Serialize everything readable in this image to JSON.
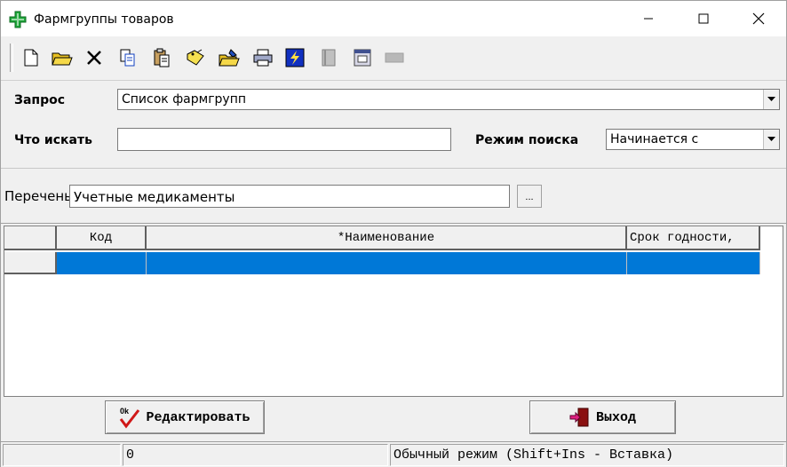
{
  "window": {
    "title": "Фармгруппы товаров"
  },
  "icons": {
    "app": "green-cross-icon",
    "toolbar": [
      "new-document-icon",
      "open-folder-icon",
      "delete-icon",
      "copy-icon",
      "paste-icon",
      "tag-icon",
      "edit-folder-icon",
      "print-icon",
      "lightning-icon",
      "notebook-icon",
      "window-icon",
      "minus-icon"
    ]
  },
  "form": {
    "query_label": "Запрос",
    "query_value": "Список фармгрупп",
    "search_label": "Что искать",
    "search_value": "",
    "mode_label": "Режим поиска",
    "mode_value": "Начинается с",
    "list_label": "Перечень",
    "list_value": "Учетные медикаменты",
    "list_button": "..."
  },
  "grid": {
    "columns": [
      "Код",
      "*Наименование",
      "Срок годности,"
    ],
    "rows": [
      {
        "code": "",
        "name": "",
        "shelf_life": ""
      }
    ]
  },
  "buttons": {
    "edit": "Редактировать",
    "edit_icon_text": "0k",
    "exit": "Выход"
  },
  "status": {
    "pane1": "",
    "pane2": "0",
    "pane3": "Обычный режим (Shift+Ins - Вставка)"
  },
  "colors": {
    "selection": "#0078d7",
    "cross": "#1fa83a"
  }
}
